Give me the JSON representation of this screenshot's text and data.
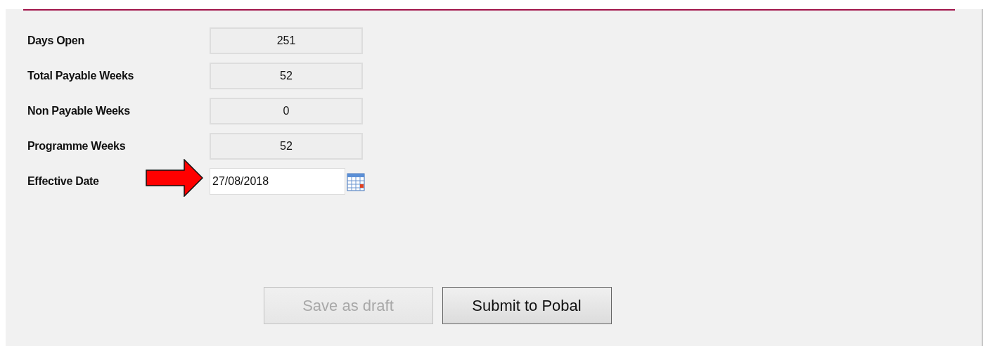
{
  "fields": [
    {
      "label": "Days Open",
      "value": "251",
      "kind": "readonly"
    },
    {
      "label": "Total Payable Weeks",
      "value": "52",
      "kind": "readonly"
    },
    {
      "label": "Non Payable Weeks",
      "value": "0",
      "kind": "readonly"
    },
    {
      "label": "Programme Weeks",
      "value": "52",
      "kind": "readonly"
    },
    {
      "label": "Effective Date",
      "value": "27/08/2018",
      "kind": "date"
    }
  ],
  "buttons": [
    {
      "label": "Save as draft",
      "disabled": true
    },
    {
      "label": "Submit to Pobal",
      "disabled": false
    }
  ]
}
